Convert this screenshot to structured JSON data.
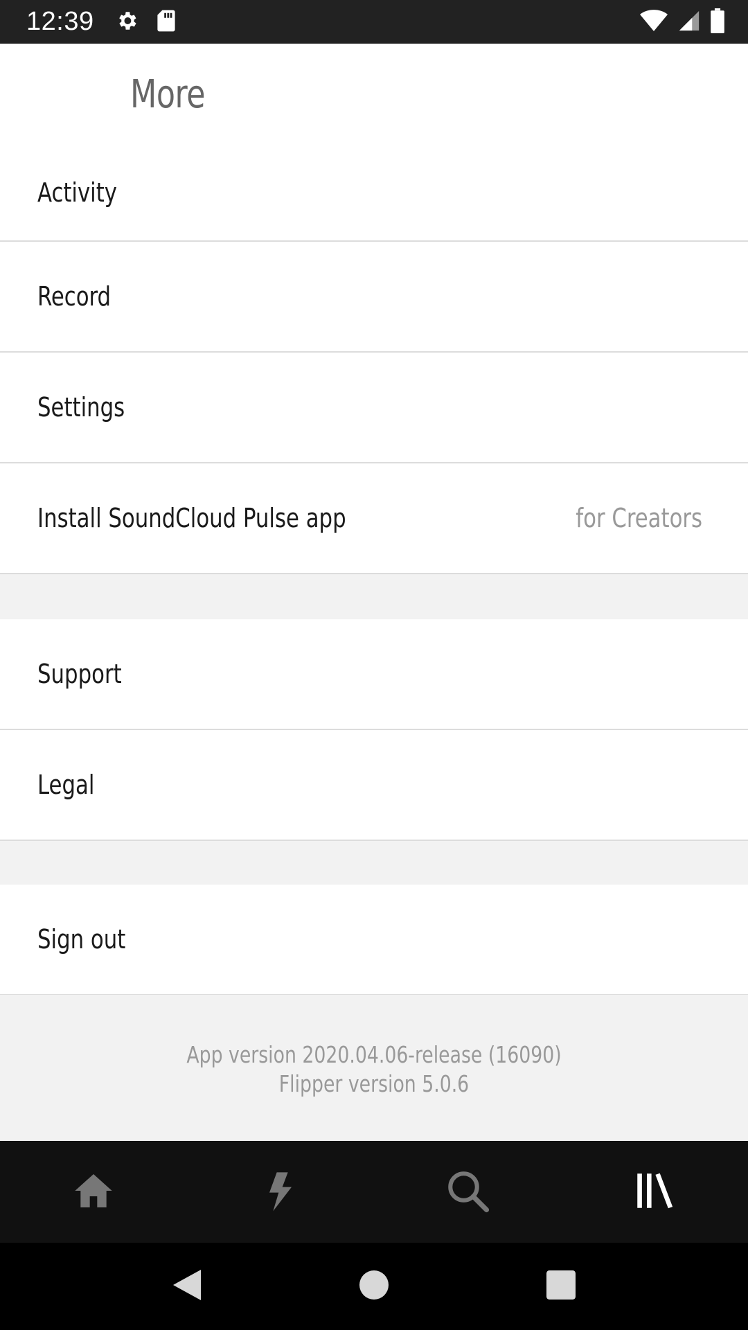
{
  "status_bar": {
    "time": "12:39",
    "icons": [
      "settings-gear-icon",
      "sd-card-icon",
      "wifi-icon",
      "signal-icon",
      "battery-icon"
    ]
  },
  "header": {
    "title": "More"
  },
  "menu": {
    "group1": [
      {
        "label": "Activity"
      },
      {
        "label": "Record"
      },
      {
        "label": "Settings"
      },
      {
        "label": "Install SoundCloud Pulse app",
        "hint": "for Creators"
      }
    ],
    "group2": [
      {
        "label": "Support"
      },
      {
        "label": "Legal"
      }
    ],
    "group3": [
      {
        "label": "Sign out"
      }
    ]
  },
  "footer": {
    "app_version": "App version 2020.04.06-release (16090)",
    "flipper_version": "Flipper version 5.0.6"
  },
  "tab_bar": {
    "tabs": [
      {
        "name": "home-icon",
        "active": false
      },
      {
        "name": "stream-lightning-icon",
        "active": false
      },
      {
        "name": "search-icon",
        "active": false
      },
      {
        "name": "library-icon",
        "active": true
      }
    ],
    "active_color": "#ffffff",
    "inactive_color": "#777777"
  },
  "nav_bar": {
    "buttons": [
      "back-icon",
      "home-circle-icon",
      "recents-square-icon"
    ]
  },
  "colors": {
    "separator": "#dcdcdc",
    "spacer_bg": "#f2f2f2",
    "status_bar_bg": "#222222",
    "tab_bar_bg": "#111111"
  }
}
